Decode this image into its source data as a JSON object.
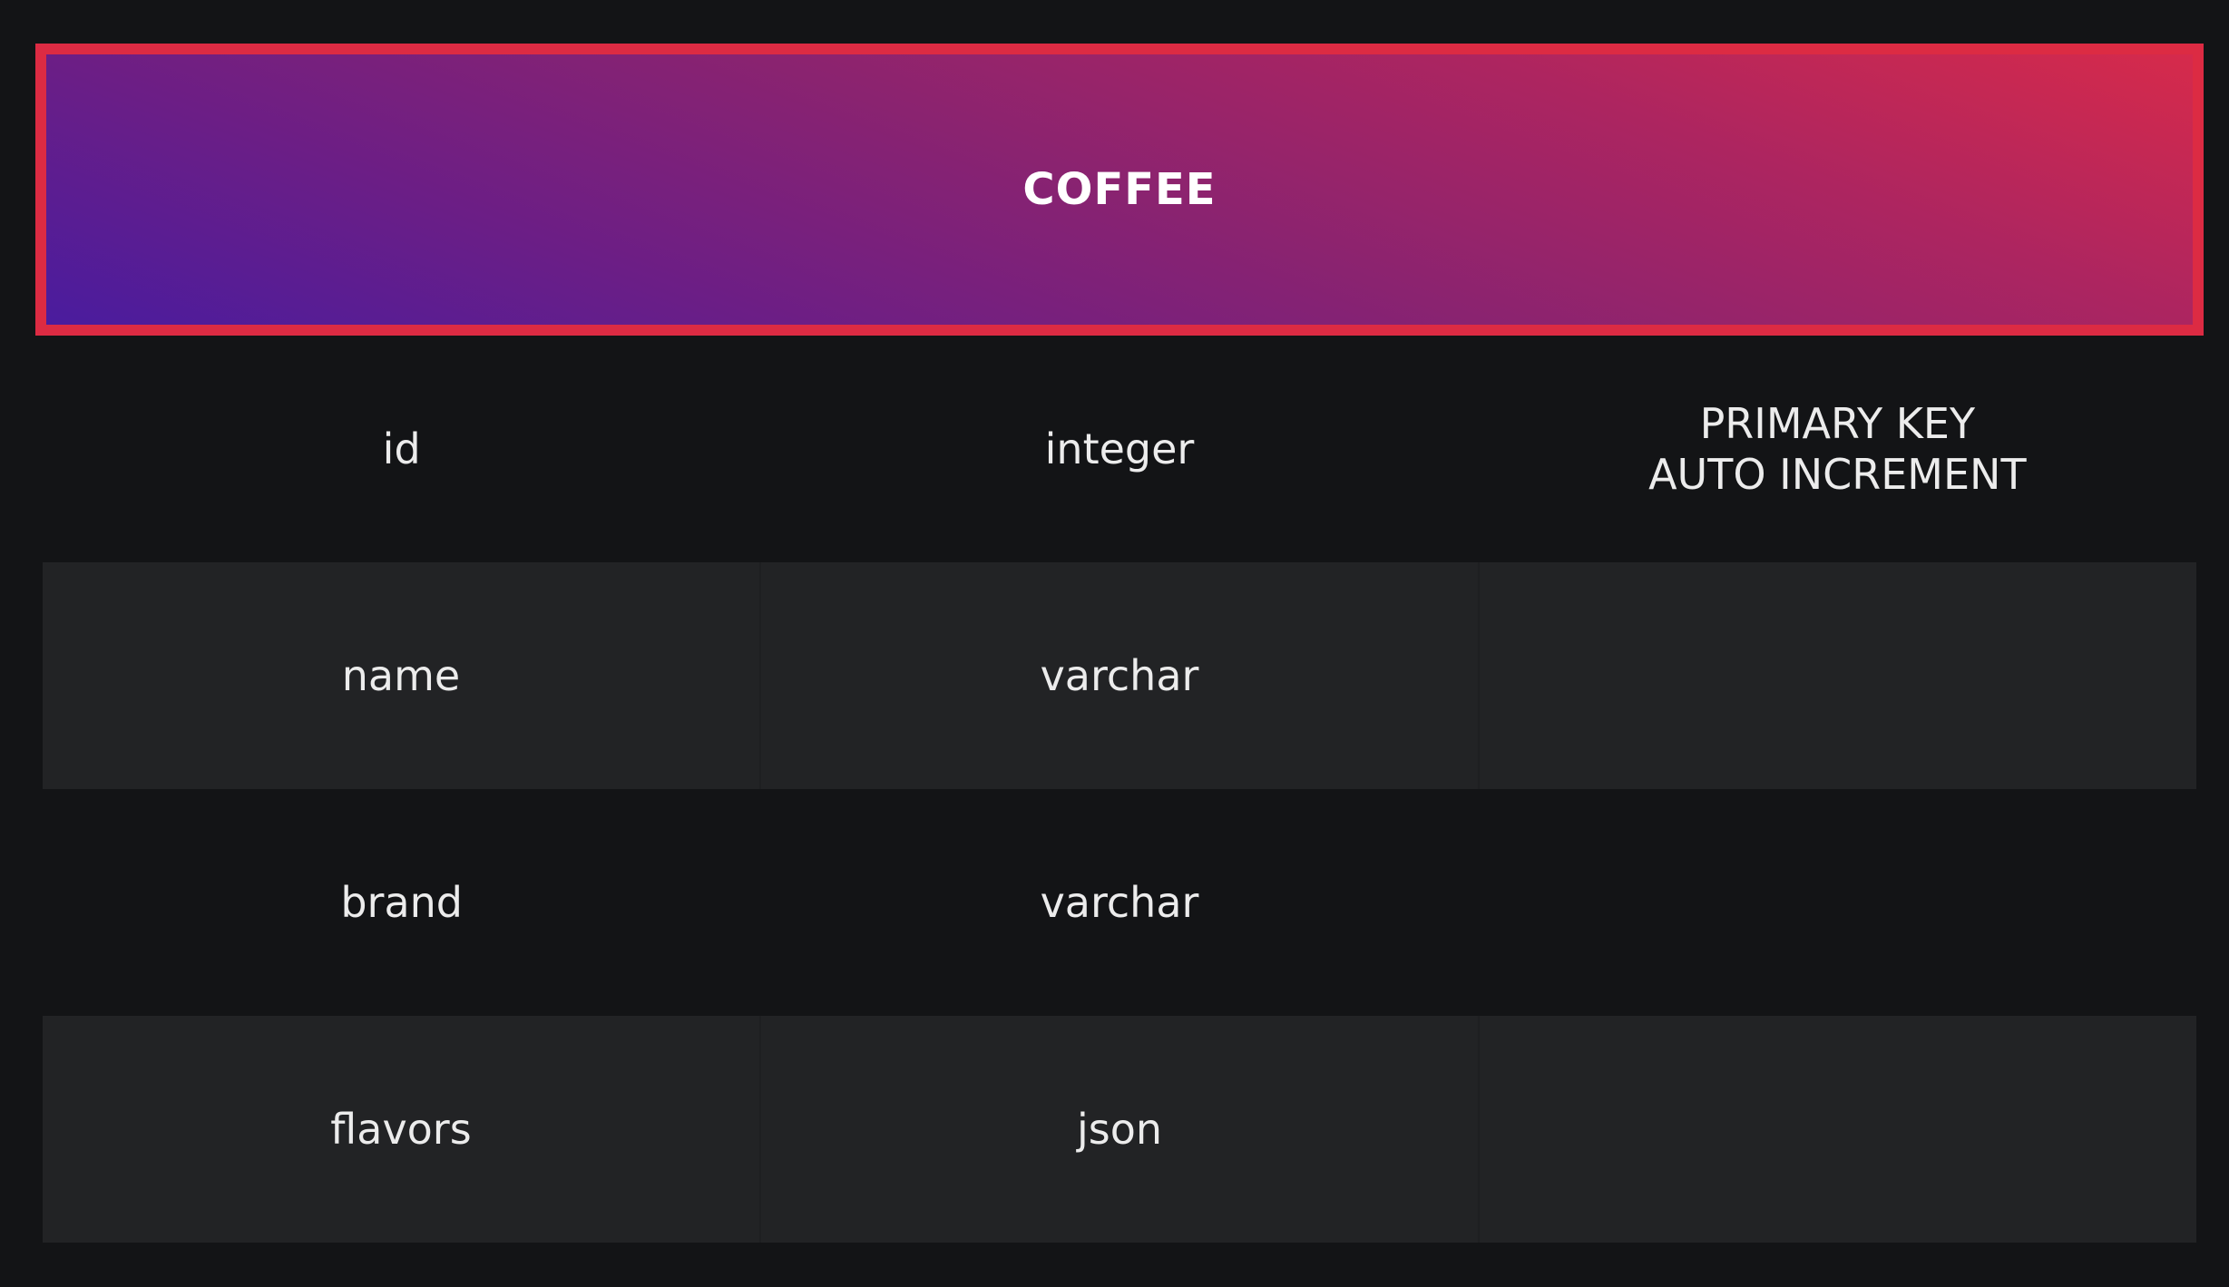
{
  "table": {
    "name": "COFFEE",
    "colors": {
      "header_border": "#dc2b43",
      "gradient_start": "#4a1c9e",
      "gradient_end": "#d62a4b",
      "background": "#131416",
      "stripe": "#222325",
      "text": "#ececec"
    },
    "rows": [
      {
        "column": "id",
        "type": "integer",
        "constraint_line1": "PRIMARY KEY",
        "constraint_line2": "AUTO INCREMENT"
      },
      {
        "column": "name",
        "type": "varchar",
        "constraint_line1": "",
        "constraint_line2": ""
      },
      {
        "column": "brand",
        "type": "varchar",
        "constraint_line1": "",
        "constraint_line2": ""
      },
      {
        "column": "flavors",
        "type": "json",
        "constraint_line1": "",
        "constraint_line2": ""
      }
    ]
  }
}
